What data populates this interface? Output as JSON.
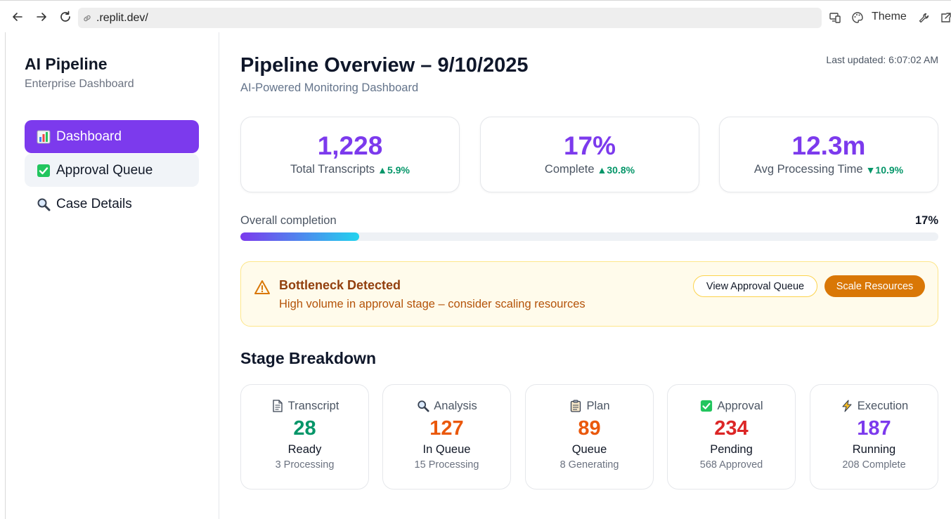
{
  "browser": {
    "url": ".replit.dev/",
    "theme_label": "Theme"
  },
  "sidebar": {
    "title": "AI Pipeline",
    "subtitle": "Enterprise Dashboard",
    "items": [
      {
        "label": "Dashboard",
        "icon": "bar-chart-emoji",
        "active": true
      },
      {
        "label": "Approval Queue",
        "icon": "check-mark-emoji",
        "active": false
      },
      {
        "label": "Case Details",
        "icon": "magnifier-emoji",
        "active": false
      }
    ]
  },
  "header": {
    "title": "Pipeline Overview – 9/10/2025",
    "subtitle": "AI-Powered Monitoring Dashboard",
    "last_updated": "Last updated: 6:07:02 AM"
  },
  "stats": [
    {
      "value": "1,228",
      "label": "Total Transcripts",
      "trend": "▲5.9%"
    },
    {
      "value": "17%",
      "label": "Complete",
      "trend": "▲30.8%"
    },
    {
      "value": "12.3m",
      "label": "Avg Processing Time",
      "trend": "▼10.9%"
    }
  ],
  "progress": {
    "label": "Overall completion",
    "percent_text": "17%",
    "fraction": 0.17
  },
  "alert": {
    "title": "Bottleneck Detected",
    "message": "High volume in approval stage – consider scaling resources",
    "button_secondary": "View Approval Queue",
    "button_primary": "Scale Resources"
  },
  "stages": {
    "title": "Stage Breakdown",
    "items": [
      {
        "name": "Transcript",
        "icon": "page-emoji",
        "value": "28",
        "status": "Ready",
        "sub": "3 Processing",
        "color": "#059669"
      },
      {
        "name": "Analysis",
        "icon": "magnifier-emoji",
        "value": "127",
        "status": "In Queue",
        "sub": "15 Processing",
        "color": "#ea580c"
      },
      {
        "name": "Plan",
        "icon": "clipboard-emoji",
        "value": "89",
        "status": "Queue",
        "sub": "8 Generating",
        "color": "#ea580c"
      },
      {
        "name": "Approval",
        "icon": "check-mark-emoji",
        "value": "234",
        "status": "Pending",
        "sub": "568 Approved",
        "color": "#dc2626"
      },
      {
        "name": "Execution",
        "icon": "lightning-emoji",
        "value": "187",
        "status": "Running",
        "sub": "208 Complete",
        "color": "#7c3aed"
      }
    ]
  },
  "colors": {
    "accent": "#7c3aed",
    "success": "#059669",
    "warning_bg": "#fffbeb",
    "warning_border": "#fde68a",
    "warning_button": "#d97706"
  }
}
